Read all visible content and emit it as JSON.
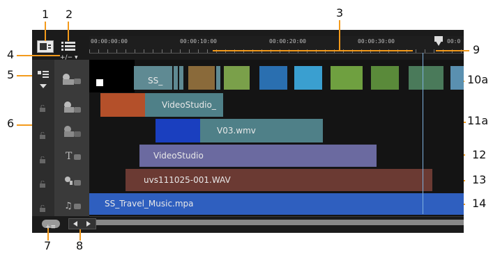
{
  "callouts": {
    "n1": "1",
    "n2": "2",
    "n3": "3",
    "n4": "4",
    "n5": "5",
    "n6": "6",
    "n7": "7",
    "n8": "8",
    "n9": "9",
    "n10a": "10a",
    "n11a": "11a",
    "n12": "12",
    "n13": "13",
    "n14": "14"
  },
  "toolbar": {
    "zoom_label": "+/− ▾"
  },
  "ruler": {
    "t0": "00:00:00:00",
    "t1": "00:00:10:00",
    "t2": "00:00:20:00",
    "t3": "00:00:30:00",
    "t4": "00:0"
  },
  "clips": {
    "video_main": "SS_",
    "overlay1": "VideoStudio_",
    "overlay2": "V03.wmv",
    "title": "VideoStudio",
    "voice": "uvs111025-001.WAV",
    "music": "SS_Travel_Music.mpa"
  },
  "colors": {
    "accent": "#f39a1c",
    "video_clip": "#5f8a93",
    "overlay_clip": "#4f8088",
    "title_clip": "#6b6aa0",
    "voice_clip": "#6b3a33",
    "music_clip": "#2f5fbf",
    "playhead": "#7fb2e0"
  }
}
